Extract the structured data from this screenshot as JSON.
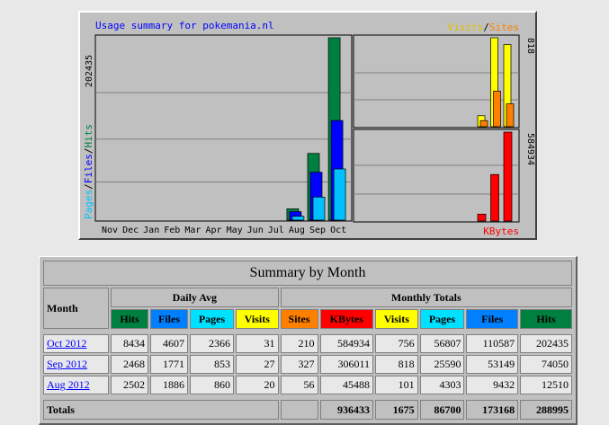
{
  "chart_data": {
    "type": "bar",
    "title": "Usage summary for pokemania.nl",
    "categories": [
      "Nov",
      "Dec",
      "Jan",
      "Feb",
      "Mar",
      "Apr",
      "May",
      "Jun",
      "Jul",
      "Aug",
      "Sep",
      "Oct"
    ],
    "left_panel": {
      "ylabel_parts": [
        "Pages",
        "Files",
        "Hits"
      ],
      "ymax_label": "202435",
      "ymax": 202435,
      "series": [
        {
          "name": "Hits",
          "color": "#008040",
          "values": [
            0,
            0,
            0,
            0,
            0,
            0,
            0,
            0,
            0,
            12510,
            74050,
            202435
          ]
        },
        {
          "name": "Files",
          "color": "#0000ff",
          "values": [
            0,
            0,
            0,
            0,
            0,
            0,
            0,
            0,
            0,
            9432,
            53149,
            110587
          ]
        },
        {
          "name": "Pages",
          "color": "#00c0ff",
          "values": [
            0,
            0,
            0,
            0,
            0,
            0,
            0,
            0,
            0,
            4303,
            25590,
            56807
          ]
        }
      ]
    },
    "right_top_panel": {
      "label_parts": [
        "Visits",
        "Sites"
      ],
      "ymax_label": "818",
      "ymax": 818,
      "months": [
        "Aug",
        "Sep",
        "Oct"
      ],
      "series": [
        {
          "name": "Visits",
          "color": "#ffff00",
          "values": [
            101,
            818,
            756
          ]
        },
        {
          "name": "Sites",
          "color": "#ff8000",
          "values": [
            56,
            327,
            210
          ]
        }
      ]
    },
    "right_bottom_panel": {
      "label": "KBytes",
      "ymax_label": "584934",
      "ymax": 584934,
      "months": [
        "Aug",
        "Sep",
        "Oct"
      ],
      "series": [
        {
          "name": "KBytes",
          "color": "#ff0000",
          "values": [
            45488,
            306011,
            584934
          ]
        }
      ]
    }
  },
  "summary": {
    "title": "Summary by Month",
    "month_header": "Month",
    "daily_avg_header": "Daily Avg",
    "monthly_totals_header": "Monthly Totals",
    "columns": [
      {
        "label": "Hits",
        "color": "#008040",
        "text": "#000000"
      },
      {
        "label": "Files",
        "color": "#0080ff",
        "text": "#000000"
      },
      {
        "label": "Pages",
        "color": "#00e0ff",
        "text": "#000000"
      },
      {
        "label": "Visits",
        "color": "#ffff00",
        "text": "#000000"
      },
      {
        "label": "Sites",
        "color": "#ff8000",
        "text": "#000000"
      },
      {
        "label": "KBytes",
        "color": "#ff0000",
        "text": "#000000"
      },
      {
        "label": "Visits",
        "color": "#ffff00",
        "text": "#000000"
      },
      {
        "label": "Pages",
        "color": "#00e0ff",
        "text": "#000000"
      },
      {
        "label": "Files",
        "color": "#0080ff",
        "text": "#000000"
      },
      {
        "label": "Hits",
        "color": "#008040",
        "text": "#000000"
      }
    ],
    "rows": [
      {
        "month": "Oct 2012",
        "values": [
          "8434",
          "4607",
          "2366",
          "31",
          "210",
          "584934",
          "756",
          "56807",
          "110587",
          "202435"
        ]
      },
      {
        "month": "Sep 2012",
        "values": [
          "2468",
          "1771",
          "853",
          "27",
          "327",
          "306011",
          "818",
          "25590",
          "53149",
          "74050"
        ]
      },
      {
        "month": "Aug 2012",
        "values": [
          "2502",
          "1886",
          "860",
          "20",
          "56",
          "45488",
          "101",
          "4303",
          "9432",
          "12510"
        ]
      }
    ],
    "totals_label": "Totals",
    "totals": [
      "936433",
      "1675",
      "86700",
      "173168",
      "288995"
    ]
  }
}
